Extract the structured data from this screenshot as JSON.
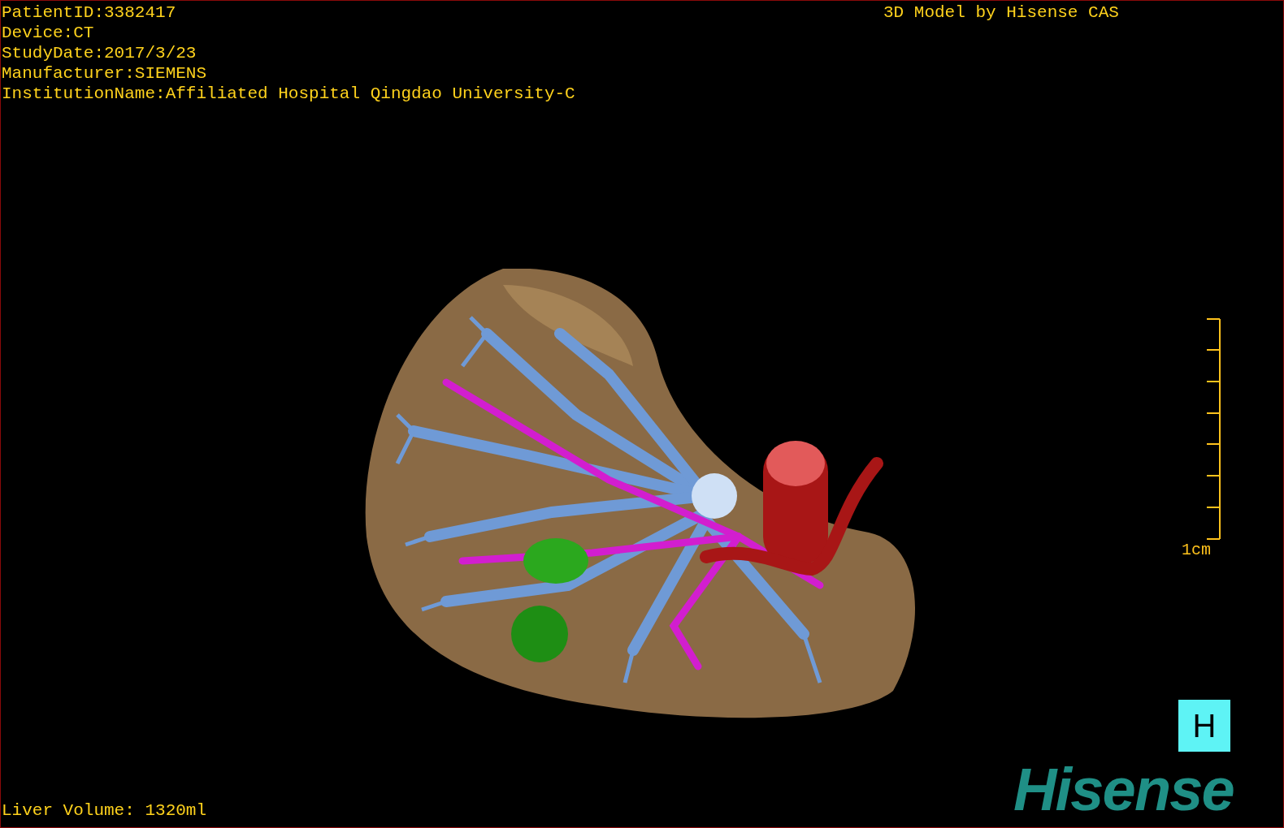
{
  "info_lines": [
    "PatientID:3382417",
    "Device:CT",
    "StudyDate:2017/3/23",
    "Manufacturer:SIEMENS",
    "InstitutionName:Affiliated Hospital Qingdao University-C"
  ],
  "model_title": "3D Model by Hisense CAS",
  "scale_bar": {
    "label": "1cm"
  },
  "view_button": "H",
  "logo": "Hisense",
  "liver_volume": "Liver Volume: 1320ml"
}
